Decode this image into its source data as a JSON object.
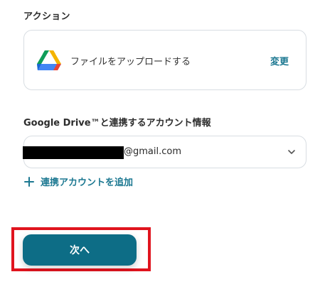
{
  "action_section": {
    "label": "アクション",
    "card": {
      "icon": "google-drive-icon",
      "title": "ファイルをアップロードする",
      "change_label": "変更"
    }
  },
  "account_section": {
    "label": "Google Drive™と連携するアカウント情報",
    "selected_account": "@gmail.com",
    "add_account_label": "連携アカウントを追加"
  },
  "footer": {
    "next_label": "次へ"
  },
  "colors": {
    "accent": "#1c7891",
    "button": "#0d6d86",
    "highlight": "#e0141e",
    "border": "#d8dde2"
  }
}
